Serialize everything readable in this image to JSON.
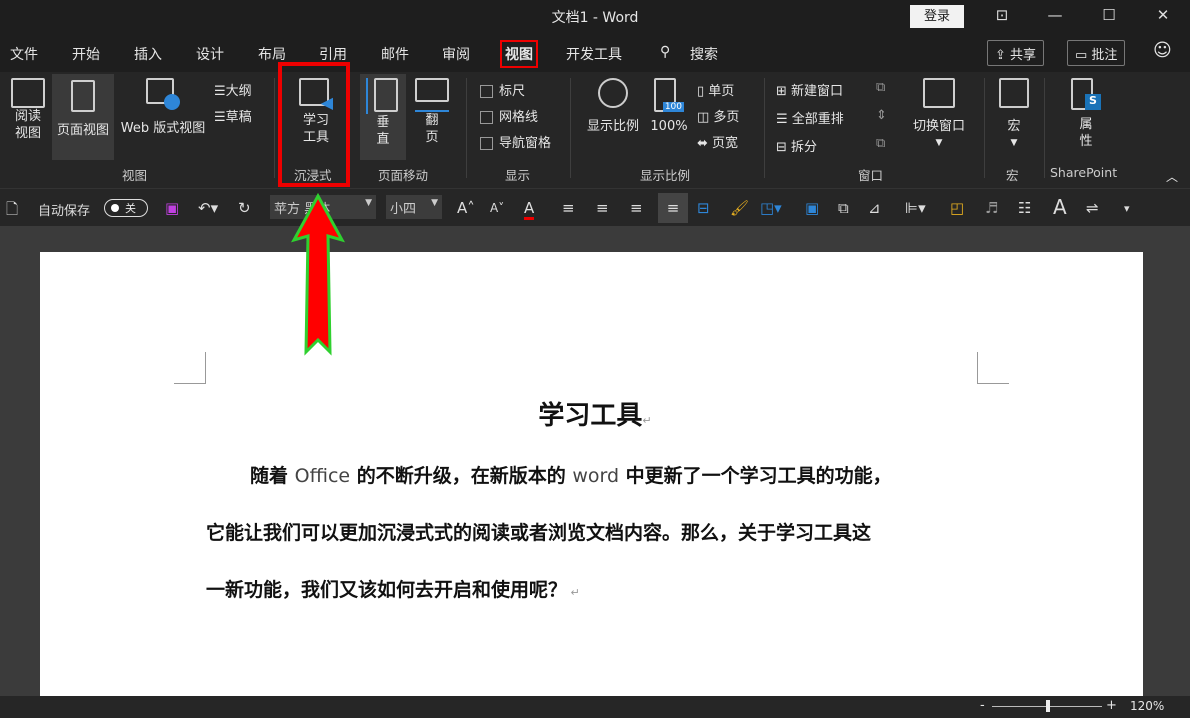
{
  "window": {
    "title": "文档1  -  Word",
    "login": "登录",
    "controls": [
      "⊡",
      "—",
      "☐",
      "✕"
    ]
  },
  "tabs": [
    "文件",
    "开始",
    "插入",
    "设计",
    "布局",
    "引用",
    "邮件",
    "审阅",
    "视图",
    "开发工具",
    "搜索"
  ],
  "tab_active": "视图",
  "share": "共享",
  "comments": "批注",
  "ribbon": {
    "views": {
      "read": "阅读视图",
      "read1": "阅读",
      "read2": "视图",
      "print": "页面视图",
      "web": "Web 版式视图",
      "outline": "大纲",
      "draft": "草稿",
      "group": "视图"
    },
    "immersive": {
      "tool1": "学习",
      "tool2": "工具",
      "group": "沉浸式"
    },
    "movement": {
      "vertical1": "垂",
      "vertical2": "直",
      "side1": "翻",
      "side2": "页",
      "group": "页面移动"
    },
    "show": {
      "ruler": "标尺",
      "gridlines": "网格线",
      "nav": "导航窗格",
      "group": "显示"
    },
    "zoom": {
      "zoom": "显示比例",
      "pct": "100%",
      "one": "单页",
      "multi": "多页",
      "width": "页宽",
      "group": "显示比例",
      "badge": "100"
    },
    "window": {
      "new": "新建窗口",
      "arrange": "全部重排",
      "split": "拆分",
      "switch": "切换窗口",
      "group": "窗口"
    },
    "macros": {
      "label": "宏",
      "group": "宏"
    },
    "sharepoint": {
      "p1": "属",
      "p2": "性",
      "group": "SharePoint"
    }
  },
  "qat": {
    "autosave": "自动保存",
    "toggle": "关",
    "font": "苹方 黑体",
    "size": "小四"
  },
  "document": {
    "heading": "学习工具",
    "lines": [
      [
        "随着 ",
        "Office",
        " 的不断升级，在新版本的 ",
        "word",
        " 中更新了一个学习工具的功能，"
      ],
      [
        "它能让我们可以更加沉浸式式的阅读或者浏览文档内容。那么，关于学习工具这"
      ],
      [
        "一新功能，我们又该如何去开启和使用呢？"
      ]
    ]
  },
  "status": {
    "zoom": "120%"
  }
}
